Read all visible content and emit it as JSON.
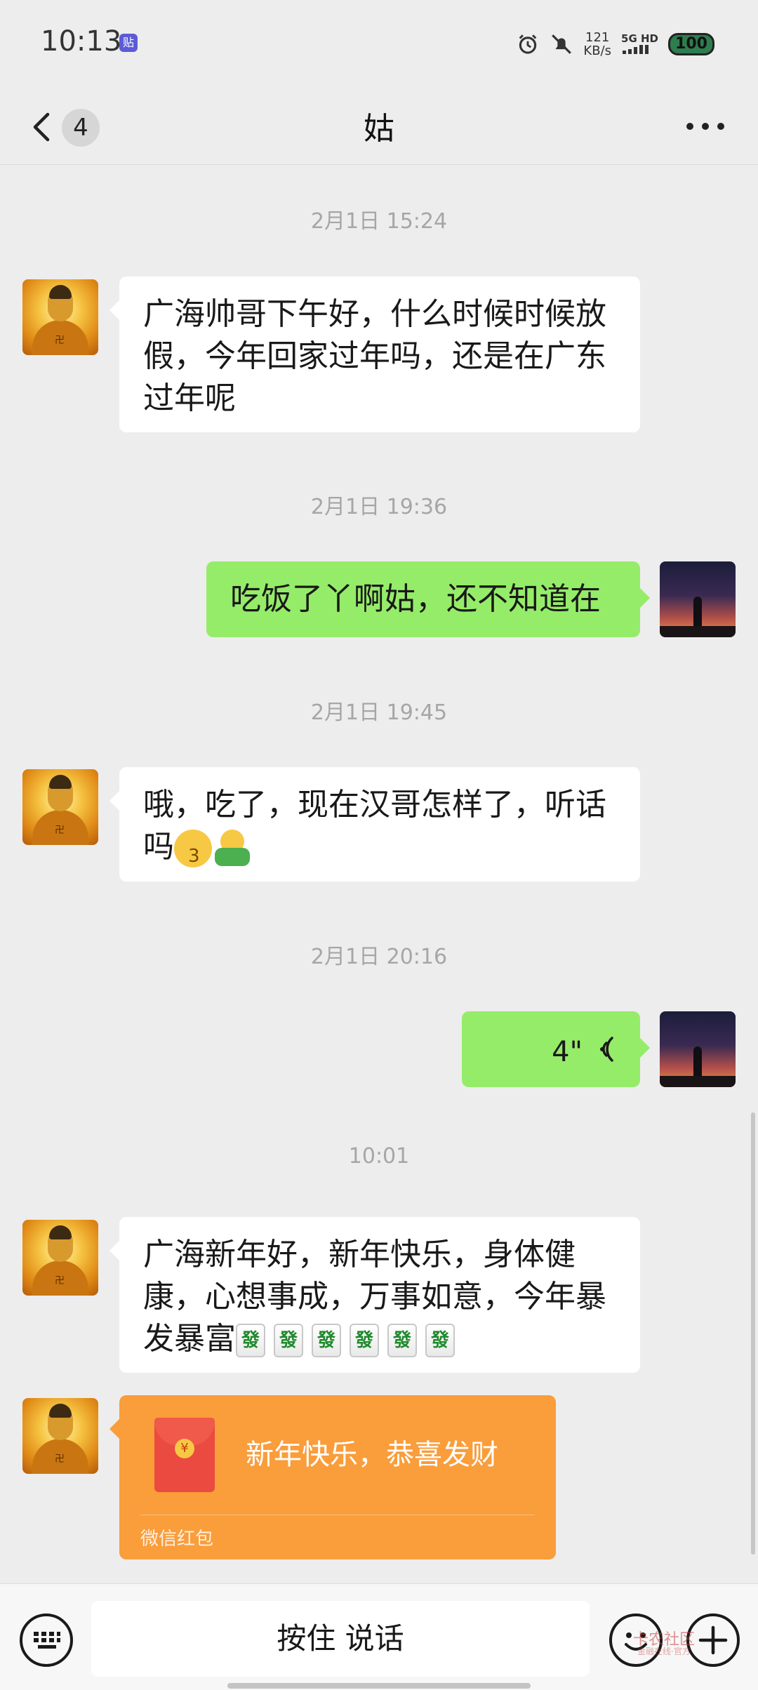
{
  "status_bar": {
    "time": "10:13",
    "app_icon_text": "贴",
    "net_speed_value": "121",
    "net_speed_unit": "KB/s",
    "signal_label": "5G HD",
    "battery": "100"
  },
  "nav": {
    "unread_count": "4",
    "title": "姑"
  },
  "messages": [
    {
      "time": "2月1日 15:24",
      "text": "广海帅哥下午好，什么时候时候放假，今年回家过年吗，还是在广东过年呢"
    },
    {
      "time": "2月1日 19:36",
      "text": "吃饭了丫啊姑，还不知道在"
    },
    {
      "time": "2月1日 19:45",
      "text": "哦，吃了，现在汉哥怎样了，听话吗"
    },
    {
      "time": "2月1日 20:16",
      "voice_duration": "4\""
    },
    {
      "time": "10:01",
      "text": "广海新年好，新年快乐，身体健康，心想事成，万事如意，今年暴发暴富",
      "tile_glyph": "發"
    }
  ],
  "red_packet": {
    "coin_symbol": "¥",
    "message": "新年快乐，恭喜发财",
    "label": "微信红包"
  },
  "input_bar": {
    "hold_to_talk": "按住 说话"
  },
  "watermark": {
    "title": "卡农社区",
    "subtitle": "金融在线·官方"
  },
  "colors": {
    "background": "#ededed",
    "bubble_self": "#95ec69",
    "bubble_other": "#ffffff",
    "red_packet": "#fa9d3b",
    "timestamp": "#a6a6a6"
  },
  "icons": [
    "back-chevron-icon",
    "more-icon",
    "voice-wave-icon",
    "keyboard-icon",
    "emoji-icon",
    "plus-icon",
    "alarm-icon",
    "mute-icon"
  ]
}
